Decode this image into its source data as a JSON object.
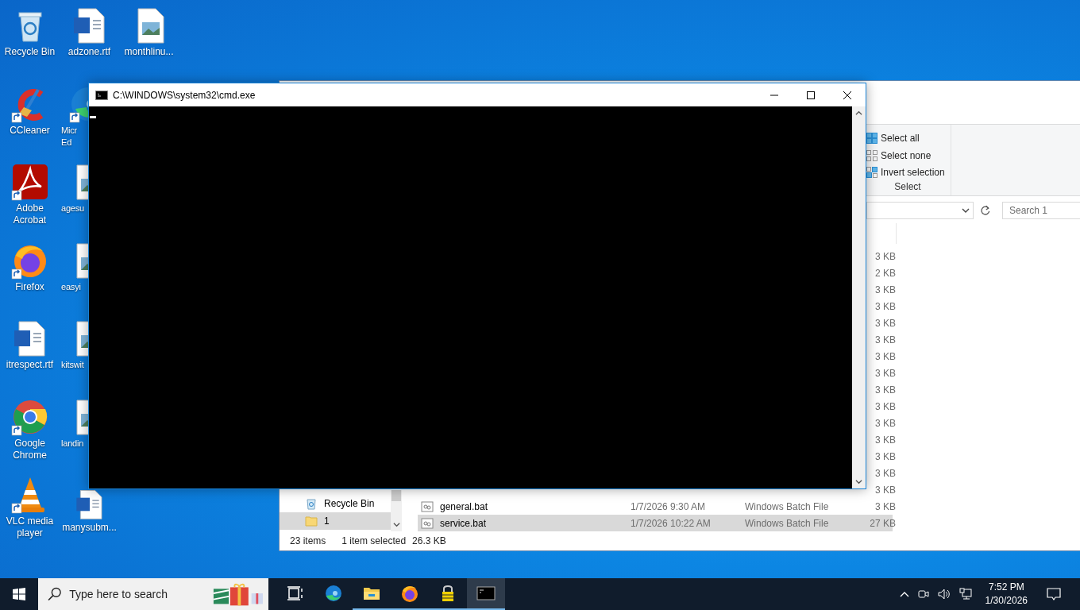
{
  "desktop": {
    "icons": [
      {
        "lines": [
          "Recycle Bin"
        ],
        "kind": "recycle",
        "shortcut": false,
        "clipped": false
      },
      {
        "lines": [
          "CCleaner"
        ],
        "kind": "ccleaner",
        "shortcut": true,
        "clipped": false
      },
      {
        "lines": [
          "Adobe",
          "Acrobat"
        ],
        "kind": "acrobat",
        "shortcut": true,
        "clipped": false
      },
      {
        "lines": [
          "Firefox"
        ],
        "kind": "firefox",
        "shortcut": true,
        "clipped": false
      },
      {
        "lines": [
          "itrespect.rtf"
        ],
        "kind": "word",
        "shortcut": false,
        "clipped": false
      },
      {
        "lines": [
          "Google",
          "Chrome"
        ],
        "kind": "chrome",
        "shortcut": true,
        "clipped": false
      },
      {
        "lines": [
          "VLC media",
          "player"
        ],
        "kind": "vlc",
        "shortcut": true,
        "clipped": false
      },
      {
        "lines": [
          "adzone.rtf"
        ],
        "kind": "word",
        "shortcut": false,
        "clipped": false
      },
      {
        "lines": [
          "Micr",
          "Ed"
        ],
        "kind": "edge",
        "shortcut": true,
        "clipped": true
      },
      {
        "lines": [
          "agesu"
        ],
        "kind": "image",
        "shortcut": false,
        "clipped": true
      },
      {
        "lines": [
          "easyi"
        ],
        "kind": "image",
        "shortcut": false,
        "clipped": true
      },
      {
        "lines": [
          "kitswit"
        ],
        "kind": "image",
        "shortcut": false,
        "clipped": true
      },
      {
        "lines": [
          "landin"
        ],
        "kind": "image",
        "shortcut": false,
        "clipped": true
      },
      {
        "lines": [
          "manysubm..."
        ],
        "kind": "word",
        "shortcut": false,
        "clipped": false
      },
      {
        "lines": [
          "monthlinu..."
        ],
        "kind": "image",
        "shortcut": false,
        "clipped": false
      }
    ]
  },
  "explorer": {
    "select_group": {
      "label": "Select",
      "buttons": [
        {
          "label": "Select all",
          "kind": "all"
        },
        {
          "label": "Select none",
          "kind": "none"
        },
        {
          "label": "Invert selection",
          "kind": "invert"
        }
      ]
    },
    "search": {
      "placeholder": "Search 1"
    },
    "nav": [
      {
        "label": "Recycle Bin",
        "kind": "recycle",
        "selected": false
      },
      {
        "label": "1",
        "kind": "folder",
        "selected": true
      }
    ],
    "files": [
      {
        "size": "3 KB",
        "selected": false
      },
      {
        "size": "2 KB",
        "selected": false
      },
      {
        "size": "3 KB",
        "selected": false
      },
      {
        "size": "3 KB",
        "selected": false
      },
      {
        "size": "3 KB",
        "selected": false
      },
      {
        "size": "3 KB",
        "selected": false
      },
      {
        "size": "3 KB",
        "selected": false
      },
      {
        "size": "3 KB",
        "selected": false
      },
      {
        "size": "3 KB",
        "selected": false
      },
      {
        "size": "3 KB",
        "selected": false
      },
      {
        "size": "3 KB",
        "selected": false
      },
      {
        "size": "3 KB",
        "selected": false
      },
      {
        "size": "3 KB",
        "selected": false
      },
      {
        "size": "3 KB",
        "selected": false
      },
      {
        "size": "3 KB",
        "selected": false
      },
      {
        "name": "general.bat",
        "date": "1/7/2026 9:30 AM",
        "type": "Windows Batch File",
        "size": "3 KB",
        "selected": false
      },
      {
        "name": "service.bat",
        "date": "1/7/2026 10:22 AM",
        "type": "Windows Batch File",
        "size": "27 KB",
        "selected": true
      }
    ],
    "status": {
      "count": "23 items",
      "selection": "1 item selected",
      "size": "26.3 KB"
    }
  },
  "cmd": {
    "title": "C:\\WINDOWS\\system32\\cmd.exe"
  },
  "taskbar": {
    "search_placeholder": "Type here to search",
    "apps": [
      {
        "kind": "taskview",
        "running": false,
        "active": false
      },
      {
        "kind": "edge",
        "running": false,
        "active": false
      },
      {
        "kind": "explorer",
        "running": true,
        "active": false
      },
      {
        "kind": "firefox",
        "running": true,
        "active": false
      },
      {
        "kind": "lock",
        "running": true,
        "active": false
      },
      {
        "kind": "cmd",
        "running": true,
        "active": true
      }
    ],
    "time": "7:52 PM",
    "date": "1/30/2026"
  }
}
